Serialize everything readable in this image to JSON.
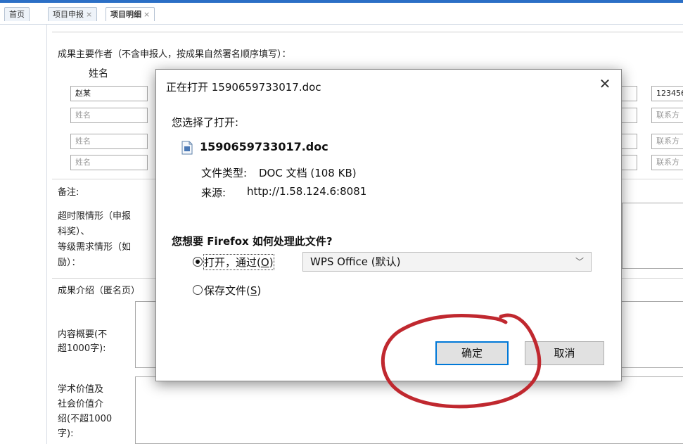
{
  "tabs": [
    {
      "label": "首页",
      "closable": false,
      "active": false
    },
    {
      "label": "项目申报",
      "closable": true,
      "active": false
    },
    {
      "label": "项目明细",
      "closable": true,
      "active": true
    }
  ],
  "form": {
    "authors_heading": "成果主要作者（不含申报人，按成果自然署名顺序填写）：",
    "columns": {
      "name": "姓名"
    },
    "rows": [
      {
        "name": "赵某",
        "contact": "123456"
      },
      {
        "name": "姓名",
        "contact": "联系方"
      },
      {
        "name": "姓名",
        "contact": "联系方"
      },
      {
        "name": "姓名",
        "contact": "联系方"
      }
    ],
    "remarks_label": "备注:",
    "remarks_line1": "超时限情形（申报",
    "remarks_line2": "科奖）、",
    "remarks_line3": "等级需求情形（如",
    "remarks_line4": "励）：",
    "intro_heading": "成果介绍（匿名页）",
    "summary_label_1": "内容概要(不",
    "summary_label_2": "超1000字):",
    "value_label_1": "学术价值及",
    "value_label_2": "社会价值介",
    "value_label_3": "绍(不超1000",
    "value_label_4": "字):"
  },
  "dialog": {
    "title": "正在打开 1590659733017.doc",
    "close_icon": "close-icon",
    "intro": "您选择了打开:",
    "filename": "1590659733017.doc",
    "filetype_label": "文件类型:",
    "filetype_value": "DOC 文档 (108 KB)",
    "source_label": "来源:",
    "source_value": "http://1.58.124.6:8081",
    "question": "您想要 Firefox 如何处理此文件?",
    "open_with_label": "打开，通过",
    "open_with_key": "O",
    "open_with_app": "WPS Office (默认)",
    "save_label": "保存文件",
    "save_key": "S",
    "ok_label": "确定",
    "cancel_label": "取消",
    "selected_option": "open"
  },
  "annotation": {
    "color": "#c0282f"
  }
}
